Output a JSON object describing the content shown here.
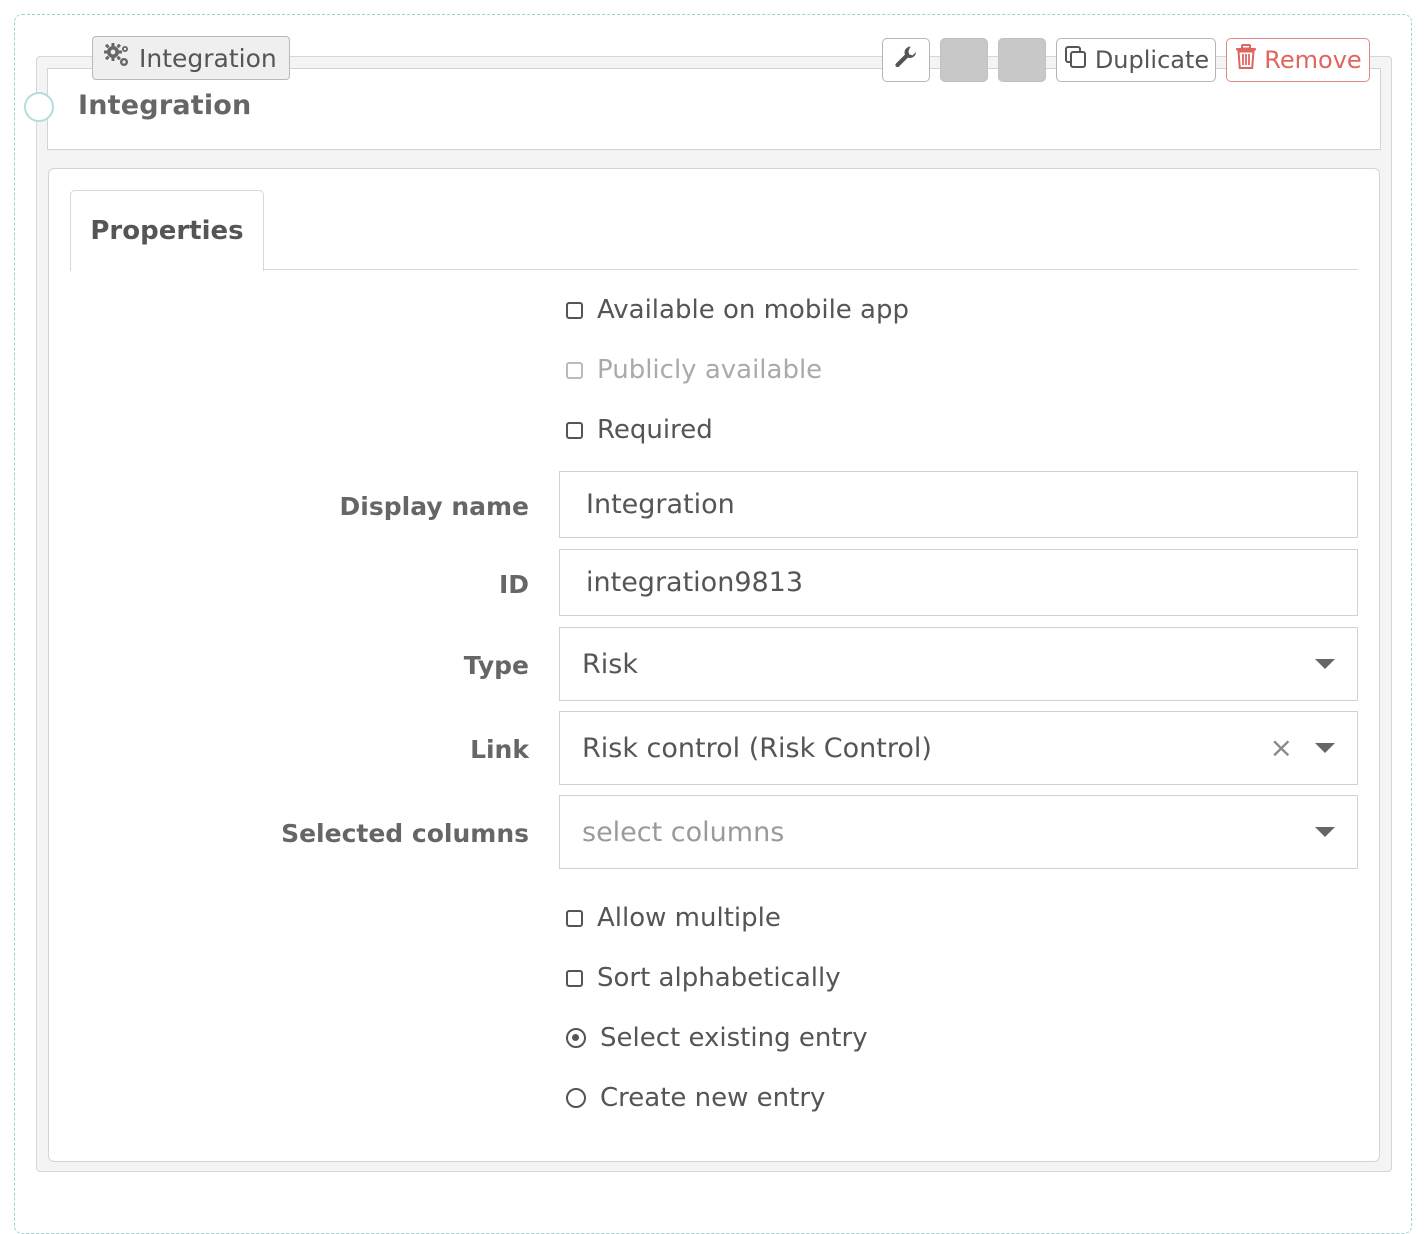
{
  "widget": {
    "chip_label": "Integration",
    "chip_icon": "cogs-icon",
    "title": "Integration"
  },
  "toolbar": {
    "wrench_icon": "wrench-icon",
    "duplicate_label": "Duplicate",
    "duplicate_icon": "copy-icon",
    "remove_label": "Remove",
    "remove_icon": "trash-icon",
    "remove_color": "#e06560"
  },
  "tabs": [
    {
      "label": "Properties",
      "active": true
    }
  ],
  "options_top": {
    "mobile": {
      "label": "Available on mobile app",
      "checked": false
    },
    "public": {
      "label": "Publicly available",
      "checked": false,
      "disabled": true
    },
    "required": {
      "label": "Required",
      "checked": false
    }
  },
  "fields": {
    "display_name": {
      "label": "Display name",
      "value": "Integration"
    },
    "id": {
      "label": "ID",
      "value": "integration9813"
    },
    "type": {
      "label": "Type",
      "value": "Risk"
    },
    "link": {
      "label": "Link",
      "value": "Risk control (Risk Control)",
      "clear": "×"
    },
    "columns": {
      "label": "Selected columns",
      "placeholder": "select columns"
    }
  },
  "options_bottom": {
    "allow_multiple": {
      "label": "Allow multiple",
      "checked": false
    },
    "sort_alpha": {
      "label": "Sort alphabetically",
      "checked": false
    },
    "select_existing": {
      "label": "Select existing entry",
      "selected": true
    },
    "create_new": {
      "label": "Create new entry",
      "selected": false
    }
  }
}
